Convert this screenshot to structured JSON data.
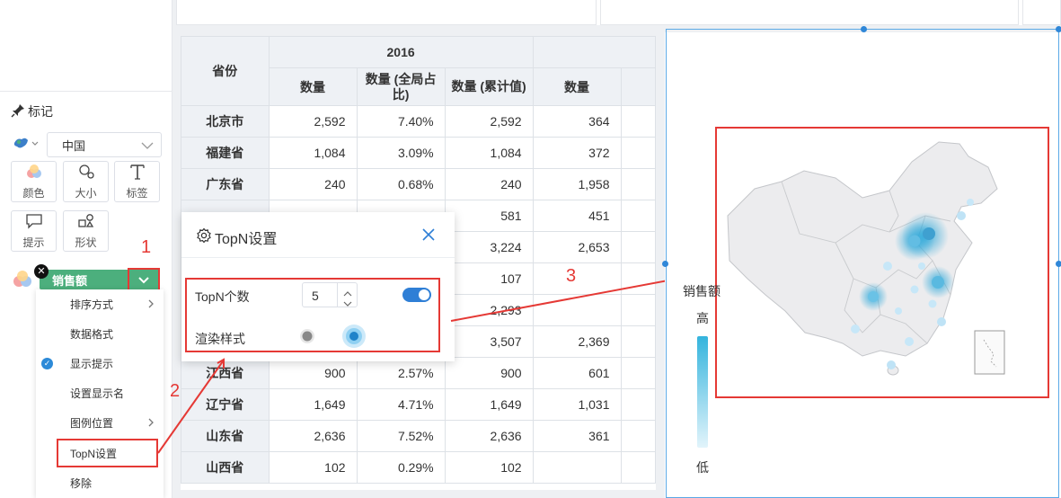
{
  "marks": {
    "title": "标记",
    "map_select": "中国",
    "buttons": [
      {
        "label": "颜色",
        "icon": "color-icon"
      },
      {
        "label": "大小",
        "icon": "size-icon"
      },
      {
        "label": "标签",
        "icon": "label-icon"
      },
      {
        "label": "提示",
        "icon": "tooltip-icon"
      },
      {
        "label": "形状",
        "icon": "shape-icon"
      }
    ],
    "field_pill": "销售额"
  },
  "context_menu": [
    {
      "label": "排序方式",
      "has_submenu": true,
      "checked": false
    },
    {
      "label": "数据格式",
      "has_submenu": false,
      "checked": false
    },
    {
      "label": "显示提示",
      "has_submenu": false,
      "checked": true
    },
    {
      "label": "设置显示名",
      "has_submenu": false,
      "checked": false
    },
    {
      "label": "图例位置",
      "has_submenu": true,
      "checked": false
    },
    {
      "label": "TopN设置",
      "has_submenu": false,
      "checked": false
    },
    {
      "label": "移除",
      "has_submenu": false,
      "checked": false
    }
  ],
  "table": {
    "row_header": "省份",
    "year": "2016",
    "columns": [
      "数量",
      "数量 (全局占比)",
      "数量 (累计值)",
      "数量"
    ],
    "rows": [
      {
        "province": "北京市",
        "values": [
          "2,592",
          "7.40%",
          "2,592",
          "364"
        ]
      },
      {
        "province": "福建省",
        "values": [
          "1,084",
          "3.09%",
          "1,084",
          "372"
        ]
      },
      {
        "province": "广东省",
        "values": [
          "240",
          "0.68%",
          "240",
          "1,958"
        ]
      },
      {
        "province": "",
        "values": [
          "",
          "",
          "581",
          "451"
        ]
      },
      {
        "province": "",
        "values": [
          "",
          "",
          "3,224",
          "2,653"
        ]
      },
      {
        "province": "",
        "values": [
          "",
          "",
          "107",
          ""
        ]
      },
      {
        "province": "",
        "values": [
          "",
          "",
          "2,293",
          ""
        ]
      },
      {
        "province": "",
        "values": [
          "",
          "",
          "3,507",
          "2,369"
        ]
      },
      {
        "province": "江西省",
        "values": [
          "900",
          "2.57%",
          "900",
          "601"
        ]
      },
      {
        "province": "辽宁省",
        "values": [
          "1,649",
          "4.71%",
          "1,649",
          "1,031"
        ]
      },
      {
        "province": "山东省",
        "values": [
          "2,636",
          "7.52%",
          "2,636",
          "361"
        ]
      },
      {
        "province": "山西省",
        "values": [
          "102",
          "0.29%",
          "102",
          ""
        ]
      }
    ]
  },
  "topn_dialog": {
    "title": "TopN设置",
    "count_label": "TopN个数",
    "count_value": "5",
    "toggle_on": true,
    "render_label": "渲染样式",
    "render_selected": 1
  },
  "annotations": [
    "1",
    "2",
    "3"
  ],
  "legend": {
    "title": "销售额",
    "high": "高",
    "low": "低",
    "gradient_top": "#34b4dd",
    "gradient_bottom": "#e2f4fb"
  },
  "colors": {
    "accent": "#2f7fd6",
    "annotation_red": "#e53935",
    "pill_green": "#4caf7d"
  }
}
